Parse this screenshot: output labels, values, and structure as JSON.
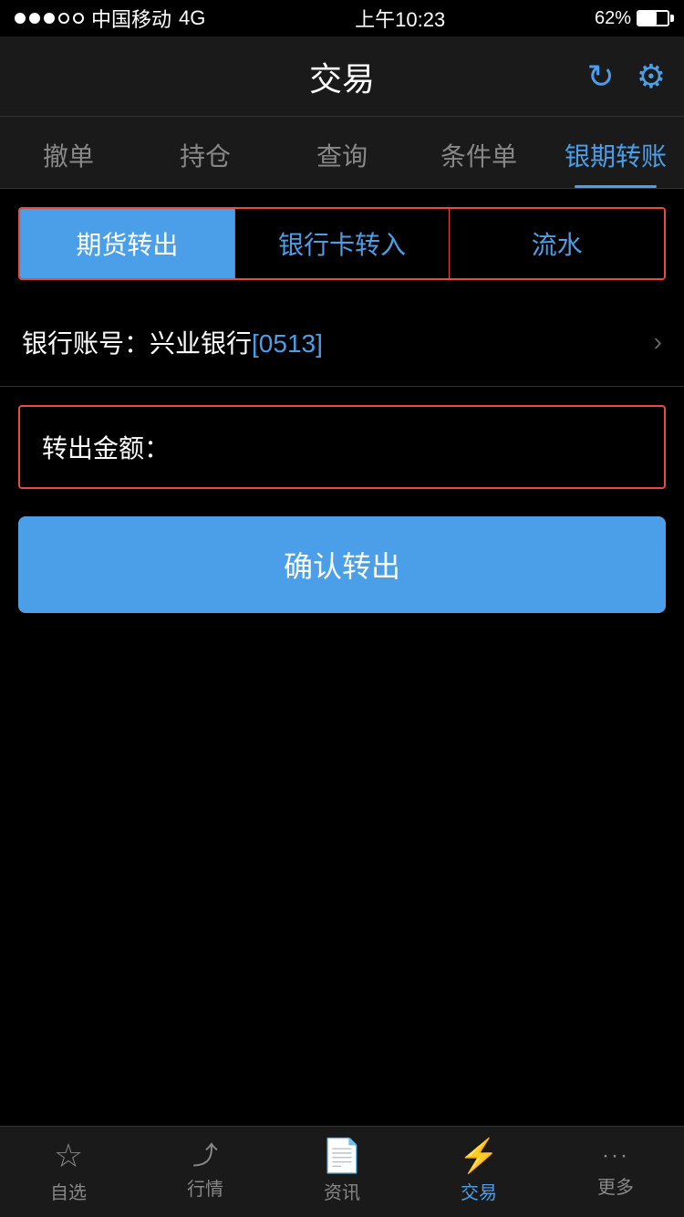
{
  "statusBar": {
    "carrier": "中国移动",
    "networkType": "4G",
    "time": "上午10:23",
    "battery": "62%"
  },
  "header": {
    "title": "交易",
    "refreshLabel": "refresh",
    "settingsLabel": "settings"
  },
  "navTabs": [
    {
      "id": "cancel-order",
      "label": "撤单",
      "active": false
    },
    {
      "id": "position",
      "label": "持仓",
      "active": false
    },
    {
      "id": "query",
      "label": "查询",
      "active": false
    },
    {
      "id": "condition-order",
      "label": "条件单",
      "active": false
    },
    {
      "id": "bank-transfer",
      "label": "银期转账",
      "active": true
    }
  ],
  "subTabs": [
    {
      "id": "futures-out",
      "label": "期货转出",
      "active": true
    },
    {
      "id": "bank-in",
      "label": "银行卡转入",
      "active": false
    },
    {
      "id": "flow",
      "label": "流水",
      "active": false
    }
  ],
  "bankAccount": {
    "label": "银行账号：兴业银行",
    "accountTag": "[0513]"
  },
  "amountField": {
    "label": "转出金额：",
    "placeholder": ""
  },
  "confirmButton": {
    "label": "确认转出"
  },
  "bottomNav": [
    {
      "id": "watchlist",
      "label": "自选",
      "icon": "☆",
      "active": false
    },
    {
      "id": "market",
      "label": "行情",
      "icon": "📈",
      "active": false
    },
    {
      "id": "news",
      "label": "资讯",
      "icon": "📄",
      "active": false
    },
    {
      "id": "trading",
      "label": "交易",
      "icon": "⚡",
      "active": true
    },
    {
      "id": "more",
      "label": "更多",
      "icon": "···",
      "active": false
    }
  ]
}
